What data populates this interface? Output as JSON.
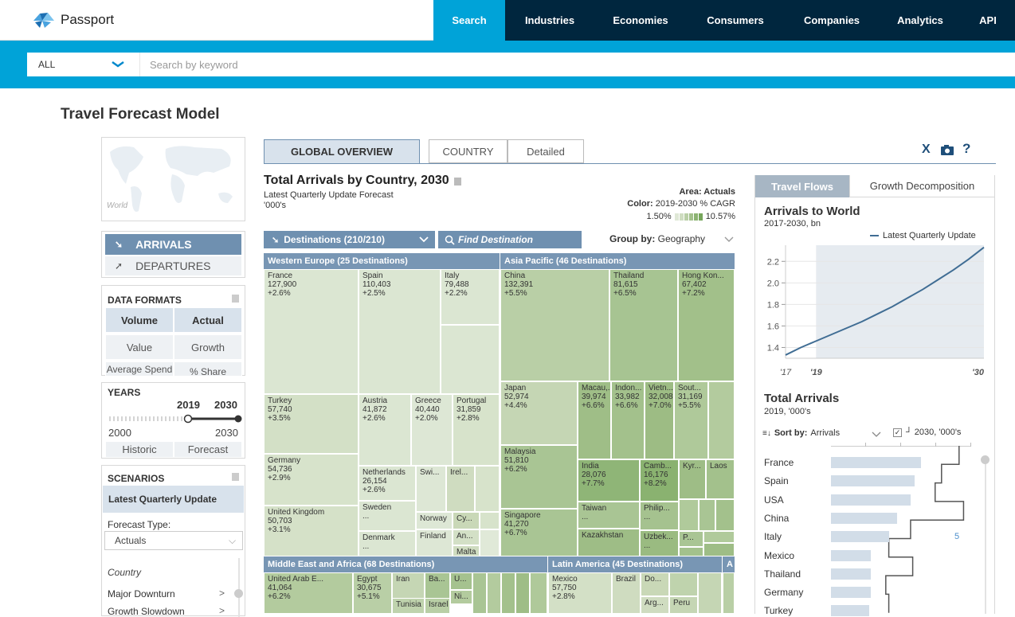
{
  "app": {
    "name": "Passport"
  },
  "nav": [
    {
      "label": "Search",
      "active": true
    },
    {
      "label": "Industries"
    },
    {
      "label": "Economies"
    },
    {
      "label": "Consumers"
    },
    {
      "label": "Companies"
    },
    {
      "label": "Analytics"
    },
    {
      "label": "API"
    }
  ],
  "search": {
    "scope": "ALL",
    "placeholder": "Search by keyword"
  },
  "page": {
    "title": "Travel Forecast Model"
  },
  "map": {
    "label": "World"
  },
  "direction": {
    "arrivals": "ARRIVALS",
    "departures": "DEPARTURES"
  },
  "data_formats": {
    "title": "DATA FORMATS",
    "volume": "Volume",
    "actual": "Actual",
    "value": "Value",
    "growth": "Growth",
    "avg_spend": "Average Spend",
    "share": "% Share"
  },
  "years": {
    "title": "YEARS",
    "start": "2019",
    "end": "2030",
    "min": "2000",
    "max": "2030",
    "historic": "Historic",
    "forecast": "Forecast"
  },
  "scenarios": {
    "title": "SCENARIOS",
    "selected": "Latest Quarterly Update",
    "forecast_type_label": "Forecast Type:",
    "forecast_type": "Actuals",
    "country_label": "Country",
    "items": [
      "Major Downturn",
      "Growth Slowdown"
    ]
  },
  "tabs": [
    "GLOBAL OVERVIEW",
    "COUNTRY",
    "Detailed"
  ],
  "tools": {
    "excel": "X",
    "help": "?"
  },
  "treemap": {
    "title": "Total Arrivals by Country, 2030",
    "subtitle1": "Latest Quarterly Update Forecast",
    "subtitle2": "'000's",
    "area_label": "Area: Actuals",
    "color_prefix": "Color:",
    "color_label": "2019-2030 % CAGR",
    "legend_min": "1.50%",
    "legend_max": "10.57%",
    "destinations": "Destinations (210/210)",
    "find": "Find Destination",
    "group_by_label": "Group by:",
    "group_by": "Geography",
    "regions": {
      "we": "Western Europe (25 Destinations)",
      "ap": "Asia Pacific (46 Destinations)",
      "mea": "Middle East and Africa (68 Destinations)",
      "la": "Latin America (45 Destinations)",
      "more": "A"
    },
    "tiles": {
      "france": {
        "name": "France",
        "value": "127,900",
        "growth": "+2.6%"
      },
      "spain": {
        "name": "Spain",
        "value": "110,403",
        "growth": "+2.5%"
      },
      "italy": {
        "name": "Italy",
        "value": "79,488",
        "growth": "+2.2%"
      },
      "turkey": {
        "name": "Turkey",
        "value": "57,740",
        "growth": "+3.5%"
      },
      "austria": {
        "name": "Austria",
        "value": "41,872",
        "growth": "+2.6%"
      },
      "greece": {
        "name": "Greece",
        "value": "40,440",
        "growth": "+2.0%"
      },
      "portugal": {
        "name": "Portugal",
        "value": "31,859",
        "growth": "+2.8%"
      },
      "germany": {
        "name": "Germany",
        "value": "54,736",
        "growth": "+2.9%"
      },
      "netherlands": {
        "name": "Netherlands",
        "value": "26,154",
        "growth": "+2.6%"
      },
      "swi": {
        "name": "Swi..."
      },
      "irel": {
        "name": "Irel..."
      },
      "uk": {
        "name": "United Kingdom",
        "value": "50,703",
        "growth": "+3.1%"
      },
      "sweden": {
        "name": "Sweden",
        "value": "..."
      },
      "norway": {
        "name": "Norway"
      },
      "cy": {
        "name": "Cy..."
      },
      "denmark": {
        "name": "Denmark",
        "value": "..."
      },
      "finland": {
        "name": "Finland"
      },
      "an": {
        "name": "An...",
        "value": "..."
      },
      "malta": {
        "name": "Malta"
      },
      "china": {
        "name": "China",
        "value": "132,391",
        "growth": "+5.5%"
      },
      "thailand": {
        "name": "Thailand",
        "value": "81,615",
        "growth": "+6.5%"
      },
      "hongkong": {
        "name": "Hong Kon...",
        "value": "67,402",
        "growth": "+7.2%"
      },
      "japan": {
        "name": "Japan",
        "value": "52,974",
        "growth": "+4.4%"
      },
      "macau": {
        "name": "Macau,...",
        "value": "39,974",
        "growth": "+6.6%"
      },
      "indon": {
        "name": "Indon...",
        "value": "33,982",
        "growth": "+6.6%"
      },
      "vietn": {
        "name": "Vietn...",
        "value": "32,008",
        "growth": "+7.0%"
      },
      "sout": {
        "name": "Sout...",
        "value": "31,169",
        "growth": "+5.5%"
      },
      "malaysia": {
        "name": "Malaysia",
        "value": "51,810",
        "growth": "+6.2%"
      },
      "india": {
        "name": "India",
        "value": "28,076",
        "growth": "+7.7%"
      },
      "camb": {
        "name": "Camb...",
        "value": "16,176",
        "growth": "+8.2%"
      },
      "kyr": {
        "name": "Kyr..."
      },
      "laos": {
        "name": "Laos"
      },
      "philip": {
        "name": "Philip...",
        "value": "..."
      },
      "taiwan": {
        "name": "Taiwan",
        "value": "..."
      },
      "singapore": {
        "name": "Singapore",
        "value": "41,270",
        "growth": "+6.7%"
      },
      "p": {
        "name": "P..."
      },
      "kazakhstan": {
        "name": "Kazakhstan"
      },
      "uzbek": {
        "name": "Uzbek...",
        "value": "..."
      },
      "uae": {
        "name": "United Arab E...",
        "value": "41,064",
        "growth": "+6.2%"
      },
      "egypt": {
        "name": "Egypt",
        "value": "30,675",
        "growth": "+5.1%"
      },
      "iran": {
        "name": "Iran"
      },
      "ba": {
        "name": "Ba..."
      },
      "u": {
        "name": "U..."
      },
      "ni": {
        "name": "Ni..."
      },
      "tunisia": {
        "name": "Tunisia"
      },
      "israel": {
        "name": "Israel"
      },
      "mexico": {
        "name": "Mexico",
        "value": "57,750",
        "growth": "+2.8%"
      },
      "brazil": {
        "name": "Brazil"
      },
      "do": {
        "name": "Do..."
      },
      "arg": {
        "name": "Arg..."
      },
      "peru": {
        "name": "Peru"
      }
    }
  },
  "right": {
    "tabs": [
      "Travel Flows",
      "Growth Decomposition"
    ],
    "line_title": "Arrivals to World",
    "line_subtitle": "2017-2030, bn",
    "sort_label": "Sort by:",
    "sort_value": "Arrivals",
    "compare_label": "2030, '000's",
    "bars_title": "Total Arrivals",
    "bars_subtitle": "2019, '000's",
    "value_label": "5"
  },
  "chart_data": [
    {
      "type": "line",
      "title": "Arrivals to World",
      "subtitle": "2017-2030, bn",
      "xlabel": "",
      "ylabel": "",
      "x": [
        2017,
        2018,
        2019,
        2020,
        2021,
        2022,
        2023,
        2024,
        2025,
        2026,
        2027,
        2028,
        2029,
        2030
      ],
      "series": [
        {
          "name": "Latest Quarterly Update",
          "values": [
            1.33,
            1.4,
            1.46,
            1.52,
            1.58,
            1.64,
            1.71,
            1.78,
            1.86,
            1.94,
            2.03,
            2.12,
            2.22,
            2.33
          ]
        }
      ],
      "x_tick_labels": [
        "'17",
        "'19",
        "'30"
      ],
      "y_ticks": [
        1.4,
        1.6,
        1.8,
        2.0,
        2.2
      ],
      "ylim": [
        1.3,
        2.35
      ],
      "forecast_from": 2019,
      "grid": true,
      "legend": "top-right"
    },
    {
      "type": "bar",
      "title": "Total Arrivals",
      "subtitle": "2019, '000's",
      "orientation": "horizontal",
      "categories": [
        "France",
        "Spain",
        "USA",
        "China",
        "Italy",
        "Mexico",
        "Thailand",
        "Germany",
        "Turkey"
      ],
      "values": [
        90000,
        83700,
        79300,
        65700,
        58000,
        40000,
        39800,
        39600,
        38500
      ],
      "series_2030": [
        127900,
        110403,
        104000,
        132391,
        79488,
        57750,
        81615,
        54736,
        57740
      ],
      "xlim": [
        0,
        140000
      ]
    }
  ]
}
